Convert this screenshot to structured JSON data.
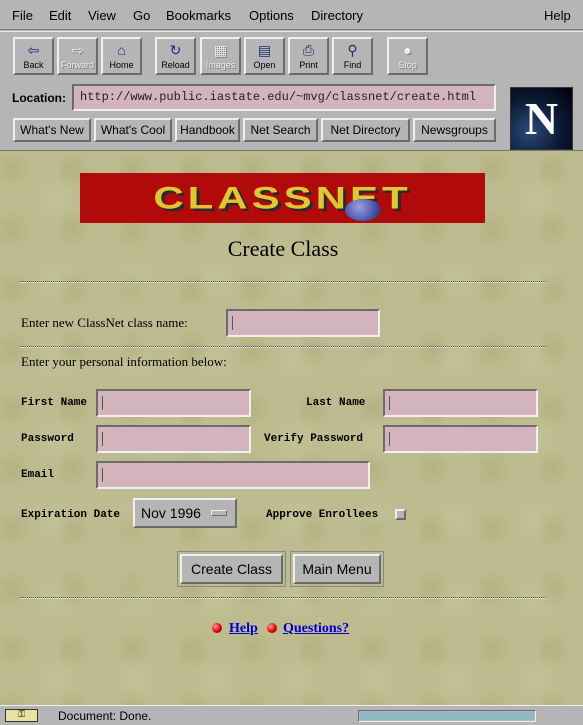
{
  "menu": {
    "file": "File",
    "edit": "Edit",
    "view": "View",
    "go": "Go",
    "bookmarks": "Bookmarks",
    "options": "Options",
    "directory": "Directory",
    "help": "Help"
  },
  "toolbar": {
    "back": "Back",
    "forward": "Forward",
    "home": "Home",
    "reload": "Reload",
    "images": "Images",
    "open": "Open",
    "print": "Print",
    "find": "Find",
    "stop": "Stop"
  },
  "location": {
    "label": "Location:",
    "url": "http://www.public.iastate.edu/~mvg/classnet/create.html"
  },
  "directory_buttons": {
    "whats_new": "What's New",
    "whats_cool": "What's Cool",
    "handbook": "Handbook",
    "net_search": "Net Search",
    "net_directory": "Net Directory",
    "newsgroups": "Newsgroups"
  },
  "logo": {
    "letter": "N"
  },
  "page": {
    "banner_text": "CLASSNET",
    "heading": "Create Class",
    "class_name_label": "Enter new ClassNet class name:",
    "personal_info_label": "Enter your personal information below:",
    "first_name_label": "First Name",
    "last_name_label": "Last Name",
    "password_label": "Password",
    "verify_password_label": "Verify Password",
    "email_label": "Email",
    "expiration_label": "Expiration Date",
    "expiration_value": "Nov 1996",
    "approve_label": "Approve Enrollees",
    "approve_checked": false,
    "create_button": "Create Class",
    "menu_button": "Main Menu",
    "help_link": "Help",
    "questions_link": "Questions?"
  },
  "status": {
    "icon": "key-icon",
    "text": "Document: Done.",
    "progress": 1.0
  },
  "colors": {
    "chrome": "#b5b5b5",
    "field": "#d4b4bc",
    "page_bg": "#bdbb8f",
    "banner": "#b10a0a",
    "link": "#0000cc"
  }
}
